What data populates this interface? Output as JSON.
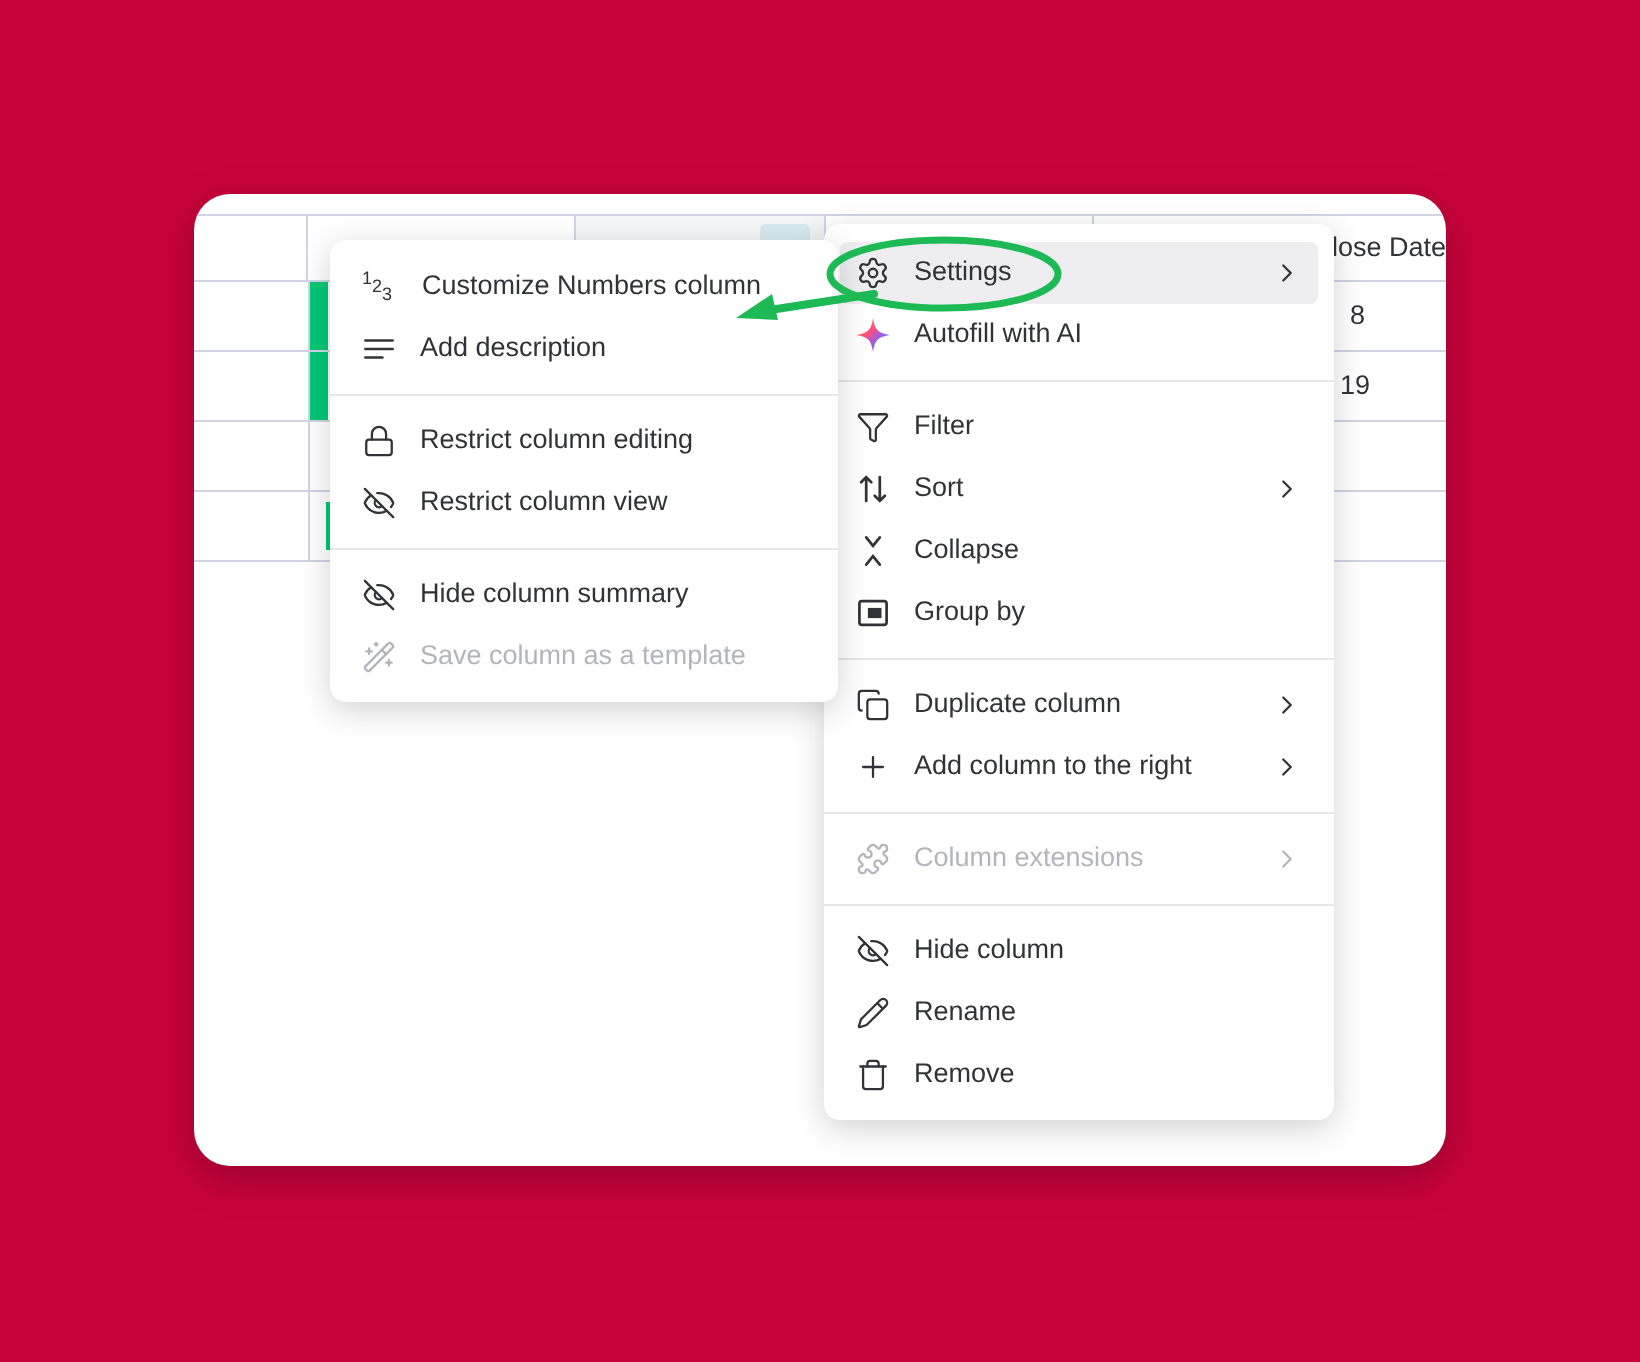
{
  "table": {
    "column_5_header": "lose Date",
    "rows": [
      {
        "kind": "bar",
        "column_5": "8"
      },
      {
        "kind": "bar",
        "column_5": "19"
      },
      {
        "kind": "empty"
      },
      {
        "kind": "thin"
      }
    ]
  },
  "column_menu": {
    "sections": [
      {
        "items": [
          {
            "label": "Settings",
            "submenu": true,
            "highlighted": true,
            "disabled": false
          },
          {
            "label": "Autofill with AI",
            "submenu": false,
            "highlighted": false,
            "disabled": false
          }
        ]
      },
      {
        "items": [
          {
            "label": "Filter",
            "submenu": false,
            "highlighted": false,
            "disabled": false
          },
          {
            "label": "Sort",
            "submenu": true,
            "highlighted": false,
            "disabled": false
          },
          {
            "label": "Collapse",
            "submenu": false,
            "highlighted": false,
            "disabled": false
          },
          {
            "label": "Group by",
            "submenu": false,
            "highlighted": false,
            "disabled": false
          }
        ]
      },
      {
        "items": [
          {
            "label": "Duplicate column",
            "submenu": true,
            "highlighted": false,
            "disabled": false
          },
          {
            "label": "Add column to the right",
            "submenu": true,
            "highlighted": false,
            "disabled": false
          }
        ]
      },
      {
        "items": [
          {
            "label": "Column extensions",
            "submenu": true,
            "highlighted": false,
            "disabled": true
          }
        ]
      },
      {
        "items": [
          {
            "label": "Hide column",
            "submenu": false,
            "highlighted": false,
            "disabled": false
          },
          {
            "label": "Rename",
            "submenu": false,
            "highlighted": false,
            "disabled": false
          },
          {
            "label": "Remove",
            "submenu": false,
            "highlighted": false,
            "disabled": false
          }
        ]
      }
    ]
  },
  "settings_submenu": {
    "sections": [
      {
        "items": [
          {
            "label": "Customize Numbers column",
            "glyph": "123",
            "disabled": false
          },
          {
            "label": "Add description",
            "disabled": false
          }
        ]
      },
      {
        "items": [
          {
            "label": "Restrict column editing",
            "disabled": false
          },
          {
            "label": "Restrict column view",
            "disabled": false
          }
        ]
      },
      {
        "items": [
          {
            "label": "Hide column summary",
            "disabled": false
          },
          {
            "label": "Save column as a template",
            "disabled": true
          }
        ]
      }
    ]
  }
}
